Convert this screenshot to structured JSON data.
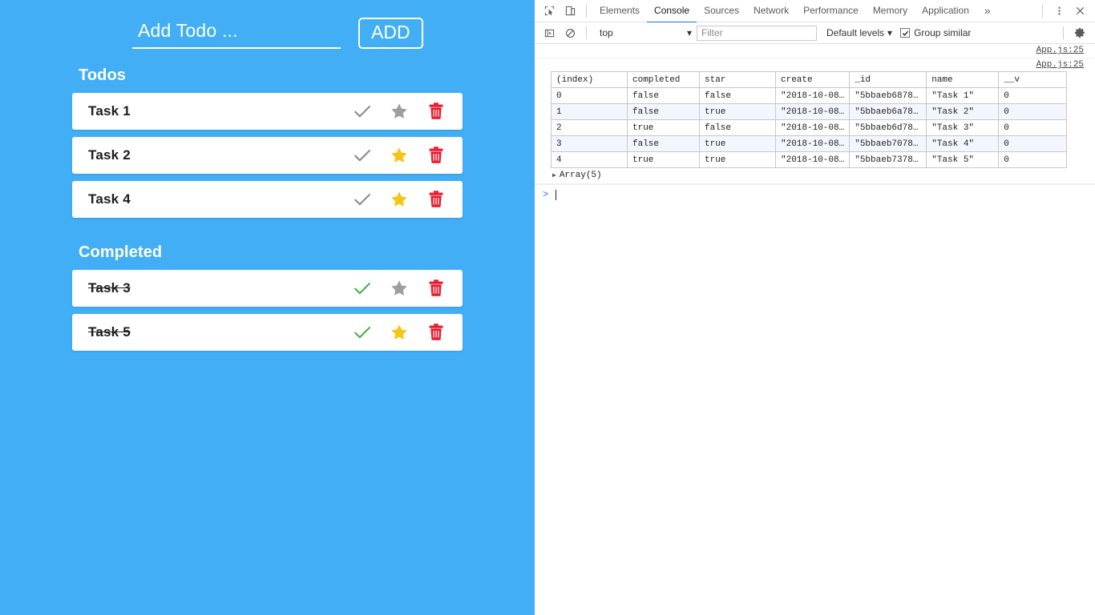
{
  "app": {
    "add_input": {
      "value": "",
      "placeholder": "Add Todo ..."
    },
    "add_button_label": "ADD",
    "todos_heading": "Todos",
    "completed_heading": "Completed",
    "accent_color": "#42AEF6",
    "star_active_color": "#F5C518",
    "star_inactive_color": "#9E9E9E",
    "check_active_color": "#4CAF50",
    "check_inactive_color": "#8A8A8A",
    "trash_color": "#E8192C",
    "todos": [
      {
        "name": "Task 1",
        "completed": false,
        "star": false
      },
      {
        "name": "Task 2",
        "completed": false,
        "star": true
      },
      {
        "name": "Task 4",
        "completed": false,
        "star": true
      }
    ],
    "completed": [
      {
        "name": "Task 3",
        "completed": true,
        "star": false
      },
      {
        "name": "Task 5",
        "completed": true,
        "star": true
      }
    ],
    "icons": {
      "check": "check-icon",
      "star": "star-icon",
      "trash": "trash-icon"
    }
  },
  "devtools": {
    "tabs": [
      {
        "label": "Elements",
        "active": false
      },
      {
        "label": "Console",
        "active": true
      },
      {
        "label": "Sources",
        "active": false
      },
      {
        "label": "Network",
        "active": false
      },
      {
        "label": "Performance",
        "active": false
      },
      {
        "label": "Memory",
        "active": false
      },
      {
        "label": "Application",
        "active": false
      }
    ],
    "overflow_label": "»",
    "active_tab_underline_color": "#1a73e8",
    "toolbar_icons": {
      "inspect": "inspect-element-icon",
      "device": "device-toolbar-icon",
      "menu": "more-options-icon",
      "close": "close-icon",
      "eval": "console-sidebar-icon",
      "clear": "clear-console-icon",
      "settings": "settings-gear-icon"
    },
    "filterbar": {
      "context": "top",
      "context_caret": "▾",
      "filter_placeholder": "Filter",
      "filter_value": "",
      "levels_label": "Default levels",
      "levels_caret": "▾",
      "group_similar_label": "Group similar",
      "group_similar_checked": true,
      "checkmark": "✔"
    },
    "console": {
      "source_links": [
        "App.js:25",
        "App.js:25"
      ],
      "array_summary": "Array(5)",
      "array_triangle": "▶",
      "prompt_arrow": ">",
      "table": {
        "headers": [
          "(index)",
          "completed",
          "star",
          "create",
          "_id",
          "name",
          "__v"
        ],
        "rows": [
          {
            "index": "0",
            "completed": "false",
            "star": "false",
            "create": "\"2018-10-08…",
            "_id": "\"5bbaeb6878…",
            "name": "\"Task 1\"",
            "__v": "0"
          },
          {
            "index": "1",
            "completed": "false",
            "star": "true",
            "create": "\"2018-10-08…",
            "_id": "\"5bbaeb6a78…",
            "name": "\"Task 2\"",
            "__v": "0"
          },
          {
            "index": "2",
            "completed": "true",
            "star": "false",
            "create": "\"2018-10-08…",
            "_id": "\"5bbaeb6d78…",
            "name": "\"Task 3\"",
            "__v": "0"
          },
          {
            "index": "3",
            "completed": "false",
            "star": "true",
            "create": "\"2018-10-08…",
            "_id": "\"5bbaeb7078…",
            "name": "\"Task 4\"",
            "__v": "0"
          },
          {
            "index": "4",
            "completed": "true",
            "star": "true",
            "create": "\"2018-10-08…",
            "_id": "\"5bbaeb7378…",
            "name": "\"Task 5\"",
            "__v": "0"
          }
        ]
      }
    }
  }
}
